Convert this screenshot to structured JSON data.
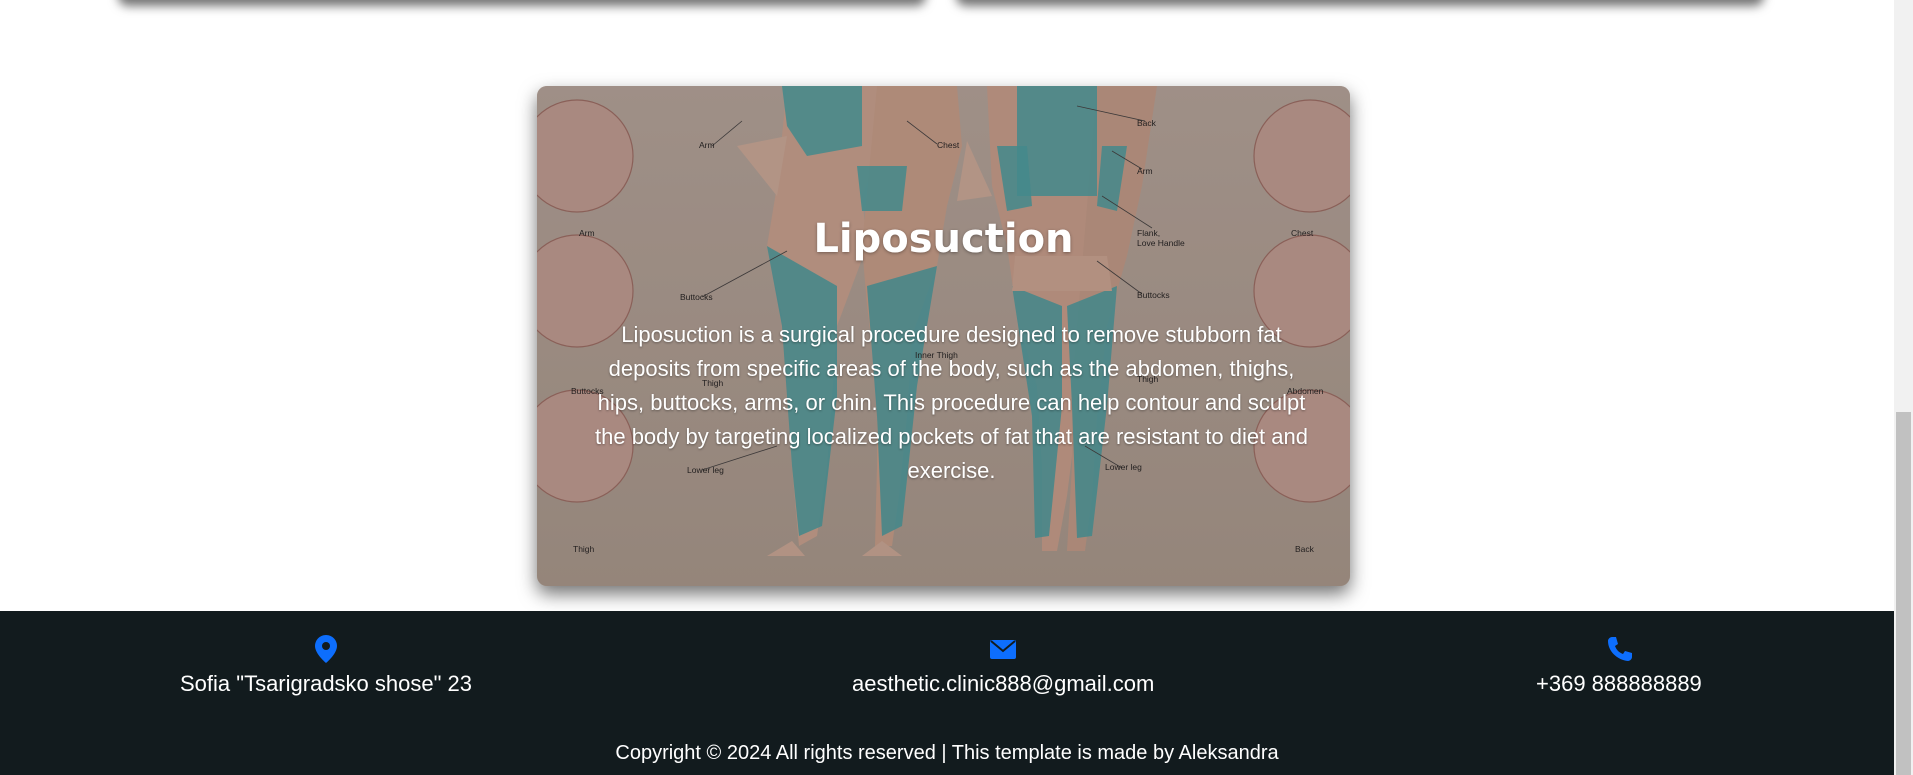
{
  "service": {
    "title": "Liposuction",
    "description": "Liposuction is a surgical procedure designed to remove stubborn fat deposits from specific areas of the body, such as the abdomen, thighs, hips, buttocks, arms, or chin. This procedure can help contour and sculpt the body by targeting localized pockets of fat that are resistant to diet and exercise.",
    "image_labels": {
      "arm_top": "Arm",
      "chest_top": "Chest",
      "back": "Back",
      "arm_right": "Arm",
      "flank_1": "Flank,",
      "flank_2": "Love Handle",
      "buttocks_left": "Buttocks",
      "buttocks_right": "Buttocks",
      "inner_thigh": "Inner Thigh",
      "thigh_left": "Thigh",
      "thigh_right": "Thigh",
      "lower_leg_left": "Lower leg",
      "lower_leg_right": "Lower leg",
      "circle_arm": "Arm",
      "circle_buttocks": "Buttocks",
      "circle_thigh": "Thigh",
      "circle_chest": "Chest",
      "circle_abdomen": "Abdomen",
      "circle_back": "Back"
    }
  },
  "footer": {
    "address": "Sofia \"Tsarigradsko shose\" 23",
    "email": "aesthetic.clinic888@gmail.com",
    "phone": "+369 888888889",
    "copyright": "Copyright © 2024 All rights reserved | This template is made by Aleksandra",
    "icons": {
      "address": "map-pin-icon",
      "email": "envelope-icon",
      "phone": "phone-icon"
    },
    "icon_color": "#0d6efd",
    "background": "#121b1e"
  }
}
